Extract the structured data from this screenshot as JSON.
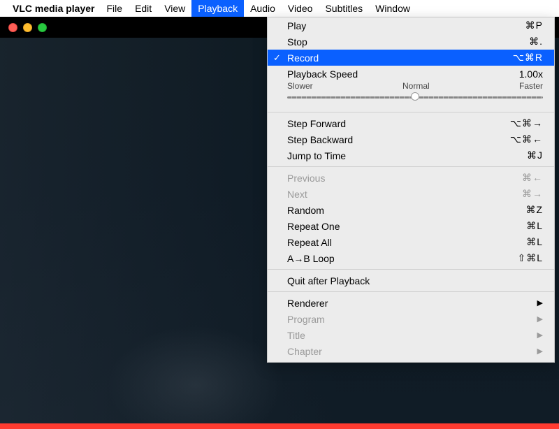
{
  "menubar": {
    "app_name": "VLC media player",
    "items": [
      {
        "label": "File"
      },
      {
        "label": "Edit"
      },
      {
        "label": "View"
      },
      {
        "label": "Playback",
        "open": true
      },
      {
        "label": "Audio"
      },
      {
        "label": "Video"
      },
      {
        "label": "Subtitles"
      },
      {
        "label": "Window"
      }
    ]
  },
  "playback_menu": {
    "play": {
      "label": "Play",
      "shortcut": "⌘P"
    },
    "stop": {
      "label": "Stop",
      "shortcut": "⌘."
    },
    "record": {
      "label": "Record",
      "shortcut": "⌥⌘R",
      "checked": true
    },
    "speed": {
      "title": "Playback Speed",
      "value": "1.00x",
      "slower": "Slower",
      "normal": "Normal",
      "faster": "Faster",
      "thumb_percent": 50
    },
    "step_forward": {
      "label": "Step Forward",
      "shortcut": "⌥⌘→"
    },
    "step_backward": {
      "label": "Step Backward",
      "shortcut": "⌥⌘←"
    },
    "jump_to_time": {
      "label": "Jump to Time",
      "shortcut": "⌘J"
    },
    "previous": {
      "label": "Previous",
      "shortcut": "⌘←",
      "disabled": true
    },
    "next": {
      "label": "Next",
      "shortcut": "⌘→",
      "disabled": true
    },
    "random": {
      "label": "Random",
      "shortcut": "⌘Z"
    },
    "repeat_one": {
      "label": "Repeat One",
      "shortcut": "⌘L"
    },
    "repeat_all": {
      "label": "Repeat All",
      "shortcut": "⌘L"
    },
    "ab_loop": {
      "label": "A→B Loop",
      "shortcut": "⇧⌘L"
    },
    "quit_after": {
      "label": "Quit after Playback"
    },
    "renderer": {
      "label": "Renderer"
    },
    "program": {
      "label": "Program",
      "disabled": true
    },
    "title": {
      "label": "Title",
      "disabled": true
    },
    "chapter": {
      "label": "Chapter",
      "disabled": true
    }
  }
}
